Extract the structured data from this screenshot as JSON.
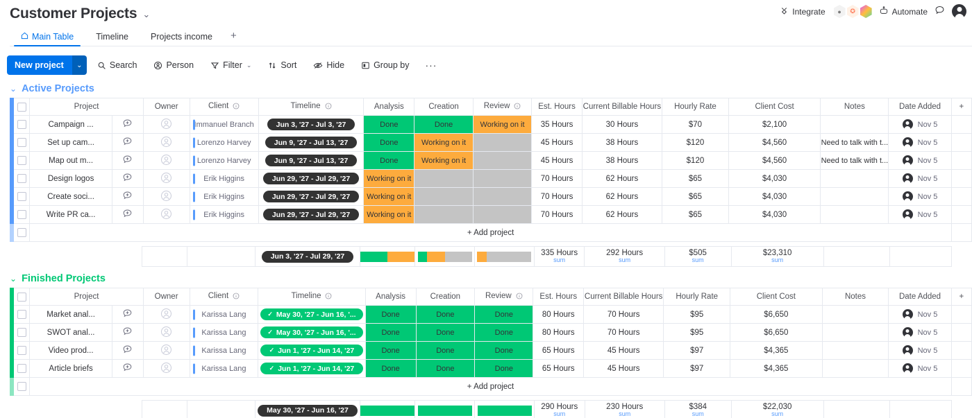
{
  "board": {
    "title": "Customer Projects",
    "chevron": "⌄"
  },
  "tabs": [
    {
      "label": "Main Table",
      "icon": "home-icon",
      "active": true
    },
    {
      "label": "Timeline",
      "active": false
    },
    {
      "label": "Projects income",
      "active": false
    }
  ],
  "tab_add": "+",
  "toolbar": {
    "new_project": "New project",
    "new_project_caret": "⌄",
    "search": "Search",
    "person": "Person",
    "filter": "Filter",
    "filter_caret": "⌄",
    "sort": "Sort",
    "hide": "Hide",
    "group_by": "Group by",
    "more": "···"
  },
  "topbar": {
    "integrate": "Integrate",
    "automate": "Automate",
    "integration_icons": [
      "slack-icon",
      "hubspot-icon",
      "gallery-icon"
    ],
    "invite_icon": "chat-bubble-icon",
    "avatar": "user-avatar"
  },
  "columns": [
    "Project",
    "Owner",
    "Client",
    "Timeline",
    "Analysis",
    "Creation",
    "Review",
    "Est. Hours",
    "Current Billable Hours",
    "Hourly Rate",
    "Client Cost",
    "Notes",
    "Date Added"
  ],
  "column_info_icons": {
    "Client": true,
    "Timeline": true,
    "Review": true
  },
  "add_column": "+",
  "add_project": "+ Add project",
  "colors": {
    "accent_blue": "#0073ea",
    "group_blue": "#579bfc",
    "group_green": "#00c875",
    "status_done": "#00c875",
    "status_working": "#fdab3d",
    "status_empty": "#c4c4c4",
    "timeline_dark": "#333333",
    "sum_label_blue": "#579bfc"
  },
  "groups": [
    {
      "name": "Active Projects",
      "color": "#579bfc",
      "chevron": "⌄",
      "rows": [
        {
          "project": "Campaign ...",
          "owner": "",
          "client": "Immanuel Branch",
          "timeline": "Jun 3, '27 - Jul 3, '27",
          "timeline_done": false,
          "analysis": "Done",
          "analysis_state": "done",
          "creation": "Done",
          "creation_state": "done",
          "review": "Working on it",
          "review_state": "working",
          "est_hours": "35 Hours",
          "billable_hours": "30 Hours",
          "hourly_rate": "$70",
          "client_cost": "$2,100",
          "notes": "",
          "date_added": "Nov 5"
        },
        {
          "project": "Set up cam...",
          "owner": "",
          "client": "Lorenzo Harvey",
          "timeline": "Jun 9, '27 - Jul 13, '27",
          "timeline_done": false,
          "analysis": "Done",
          "analysis_state": "done",
          "creation": "Working on it",
          "creation_state": "working",
          "review": "",
          "review_state": "empty",
          "est_hours": "45 Hours",
          "billable_hours": "38 Hours",
          "hourly_rate": "$120",
          "client_cost": "$4,560",
          "notes": "Need to talk with t...",
          "date_added": "Nov 5"
        },
        {
          "project": "Map out m...",
          "owner": "",
          "client": "Lorenzo Harvey",
          "timeline": "Jun 9, '27 - Jul 13, '27",
          "timeline_done": false,
          "analysis": "Done",
          "analysis_state": "done",
          "creation": "Working on it",
          "creation_state": "working",
          "review": "",
          "review_state": "empty",
          "est_hours": "45 Hours",
          "billable_hours": "38 Hours",
          "hourly_rate": "$120",
          "client_cost": "$4,560",
          "notes": "Need to talk with t...",
          "date_added": "Nov 5"
        },
        {
          "project": "Design logos",
          "owner": "",
          "client": "Erik Higgins",
          "timeline": "Jun 29, '27 - Jul 29, '27",
          "timeline_done": false,
          "analysis": "Working on it",
          "analysis_state": "working",
          "creation": "",
          "creation_state": "empty",
          "review": "",
          "review_state": "empty",
          "est_hours": "70 Hours",
          "billable_hours": "62 Hours",
          "hourly_rate": "$65",
          "client_cost": "$4,030",
          "notes": "",
          "date_added": "Nov 5"
        },
        {
          "project": "Create soci...",
          "owner": "",
          "client": "Erik Higgins",
          "timeline": "Jun 29, '27 - Jul 29, '27",
          "timeline_done": false,
          "analysis": "Working on it",
          "analysis_state": "working",
          "creation": "",
          "creation_state": "empty",
          "review": "",
          "review_state": "empty",
          "est_hours": "70 Hours",
          "billable_hours": "62 Hours",
          "hourly_rate": "$65",
          "client_cost": "$4,030",
          "notes": "",
          "date_added": "Nov 5"
        },
        {
          "project": "Write PR ca...",
          "owner": "",
          "client": "Erik Higgins",
          "timeline": "Jun 29, '27 - Jul 29, '27",
          "timeline_done": false,
          "analysis": "Working on it",
          "analysis_state": "working",
          "creation": "",
          "creation_state": "empty",
          "review": "",
          "review_state": "empty",
          "est_hours": "70 Hours",
          "billable_hours": "62 Hours",
          "hourly_rate": "$65",
          "client_cost": "$4,030",
          "notes": "",
          "date_added": "Nov 5"
        }
      ],
      "summary": {
        "timeline": "Jun 3, '27 - Jul 29, '27",
        "analysis_bar": [
          {
            "color": "#00c875",
            "pct": 50
          },
          {
            "color": "#fdab3d",
            "pct": 50
          }
        ],
        "creation_bar": [
          {
            "color": "#00c875",
            "pct": 17
          },
          {
            "color": "#fdab3d",
            "pct": 33
          },
          {
            "color": "#c4c4c4",
            "pct": 50
          }
        ],
        "review_bar": [
          {
            "color": "#fdab3d",
            "pct": 17
          },
          {
            "color": "#c4c4c4",
            "pct": 83
          }
        ],
        "est_hours": "335 Hours",
        "est_hours_label": "sum",
        "billable_hours": "292 Hours",
        "billable_hours_label": "sum",
        "hourly_rate": "$505",
        "hourly_rate_label": "sum",
        "client_cost": "$23,310",
        "client_cost_label": "sum"
      }
    },
    {
      "name": "Finished Projects",
      "color": "#00c875",
      "chevron": "⌄",
      "rows": [
        {
          "project": "Market anal...",
          "owner": "",
          "client": "Karissa Lang",
          "timeline": "May 30, '27 - Jun 16, '...",
          "timeline_done": true,
          "analysis": "Done",
          "analysis_state": "done",
          "creation": "Done",
          "creation_state": "done",
          "review": "Done",
          "review_state": "done",
          "est_hours": "80 Hours",
          "billable_hours": "70 Hours",
          "hourly_rate": "$95",
          "client_cost": "$6,650",
          "notes": "",
          "date_added": "Nov 5"
        },
        {
          "project": "SWOT anal...",
          "owner": "",
          "client": "Karissa Lang",
          "timeline": "May 30, '27 - Jun 16, '...",
          "timeline_done": true,
          "analysis": "Done",
          "analysis_state": "done",
          "creation": "Done",
          "creation_state": "done",
          "review": "Done",
          "review_state": "done",
          "est_hours": "80 Hours",
          "billable_hours": "70 Hours",
          "hourly_rate": "$95",
          "client_cost": "$6,650",
          "notes": "",
          "date_added": "Nov 5"
        },
        {
          "project": "Video prod...",
          "owner": "",
          "client": "Karissa Lang",
          "timeline": "Jun 1, '27 - Jun 14, '27",
          "timeline_done": true,
          "analysis": "Done",
          "analysis_state": "done",
          "creation": "Done",
          "creation_state": "done",
          "review": "Done",
          "review_state": "done",
          "est_hours": "65 Hours",
          "billable_hours": "45 Hours",
          "hourly_rate": "$97",
          "client_cost": "$4,365",
          "notes": "",
          "date_added": "Nov 5"
        },
        {
          "project": "Article briefs",
          "owner": "",
          "client": "Karissa Lang",
          "timeline": "Jun 1, '27 - Jun 14, '27",
          "timeline_done": true,
          "analysis": "Done",
          "analysis_state": "done",
          "creation": "Done",
          "creation_state": "done",
          "review": "Done",
          "review_state": "done",
          "est_hours": "65 Hours",
          "billable_hours": "45 Hours",
          "hourly_rate": "$97",
          "client_cost": "$4,365",
          "notes": "",
          "date_added": "Nov 5"
        }
      ],
      "summary": {
        "timeline": "May 30, '27 - Jun 16, '27",
        "analysis_bar": [
          {
            "color": "#00c875",
            "pct": 100
          }
        ],
        "creation_bar": [
          {
            "color": "#00c875",
            "pct": 100
          }
        ],
        "review_bar": [
          {
            "color": "#00c875",
            "pct": 100
          }
        ],
        "est_hours": "290 Hours",
        "est_hours_label": "sum",
        "billable_hours": "230 Hours",
        "billable_hours_label": "sum",
        "hourly_rate": "$384",
        "hourly_rate_label": "sum",
        "client_cost": "$22,030",
        "client_cost_label": "sum"
      }
    }
  ]
}
